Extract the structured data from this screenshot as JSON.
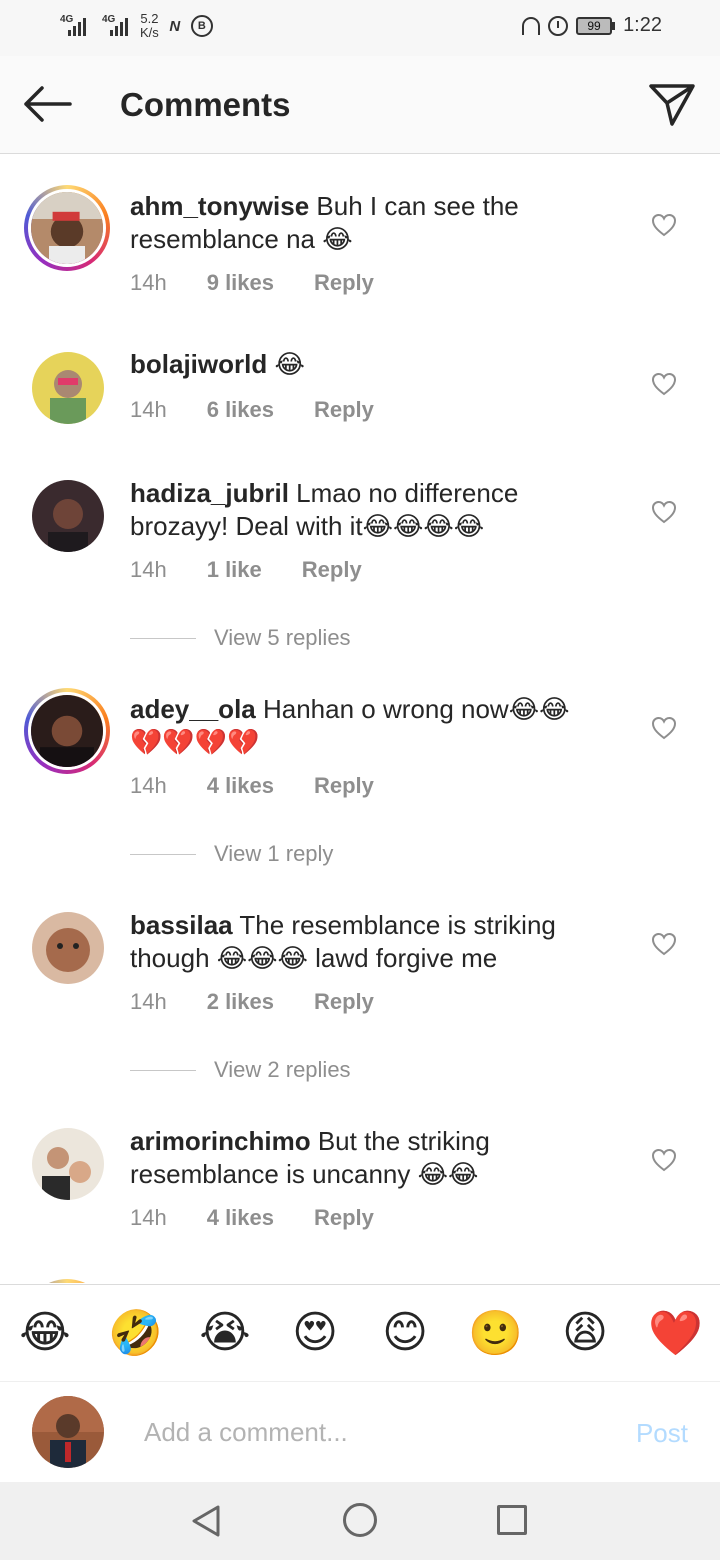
{
  "status_bar": {
    "net1": "4G",
    "net2": "4G",
    "speed_value": "5.2",
    "speed_unit": "K/s",
    "badge_n": "N",
    "badge_b": "B",
    "battery": "99",
    "time": "1:22"
  },
  "header": {
    "title": "Comments"
  },
  "comments": [
    {
      "username": "ahm_tonywise",
      "text": "Buh I can see the resemblance na 😂",
      "time": "14h",
      "likes": "9 likes",
      "reply": "Reply"
    },
    {
      "username": "bolajiworld",
      "text": "😂",
      "time": "14h",
      "likes": "6 likes",
      "reply": "Reply"
    },
    {
      "username": "hadiza_jubril",
      "text": "Lmao no difference brozayy! Deal with it😂😂😂😂",
      "time": "14h",
      "likes": "1 like",
      "reply": "Reply",
      "view_replies": "View 5 replies"
    },
    {
      "username": "adey__ola",
      "text": "Hanhan o wrong now😂😂 💔💔💔💔",
      "time": "14h",
      "likes": "4 likes",
      "reply": "Reply",
      "view_replies": "View 1 reply"
    },
    {
      "username": "bassilaa",
      "text": "The resemblance is striking though 😂😂😂 lawd forgive me",
      "time": "14h",
      "likes": "2 likes",
      "reply": "Reply",
      "view_replies": "View 2 replies"
    },
    {
      "username": "arimorinchimo",
      "text": "But the striking resemblance is uncanny 😂😂",
      "time": "14h",
      "likes": "4 likes",
      "reply": "Reply"
    }
  ],
  "emoji_bar": [
    "😂",
    "🤣",
    "😭",
    "😍",
    "😊",
    "🙂",
    "😩",
    "❤️"
  ],
  "comment_box": {
    "placeholder": "Add a comment...",
    "post_label": "Post"
  },
  "colors": {
    "post_disabled": "#b3dbff",
    "meta_gray": "#8e8e8e",
    "text": "#262626"
  }
}
